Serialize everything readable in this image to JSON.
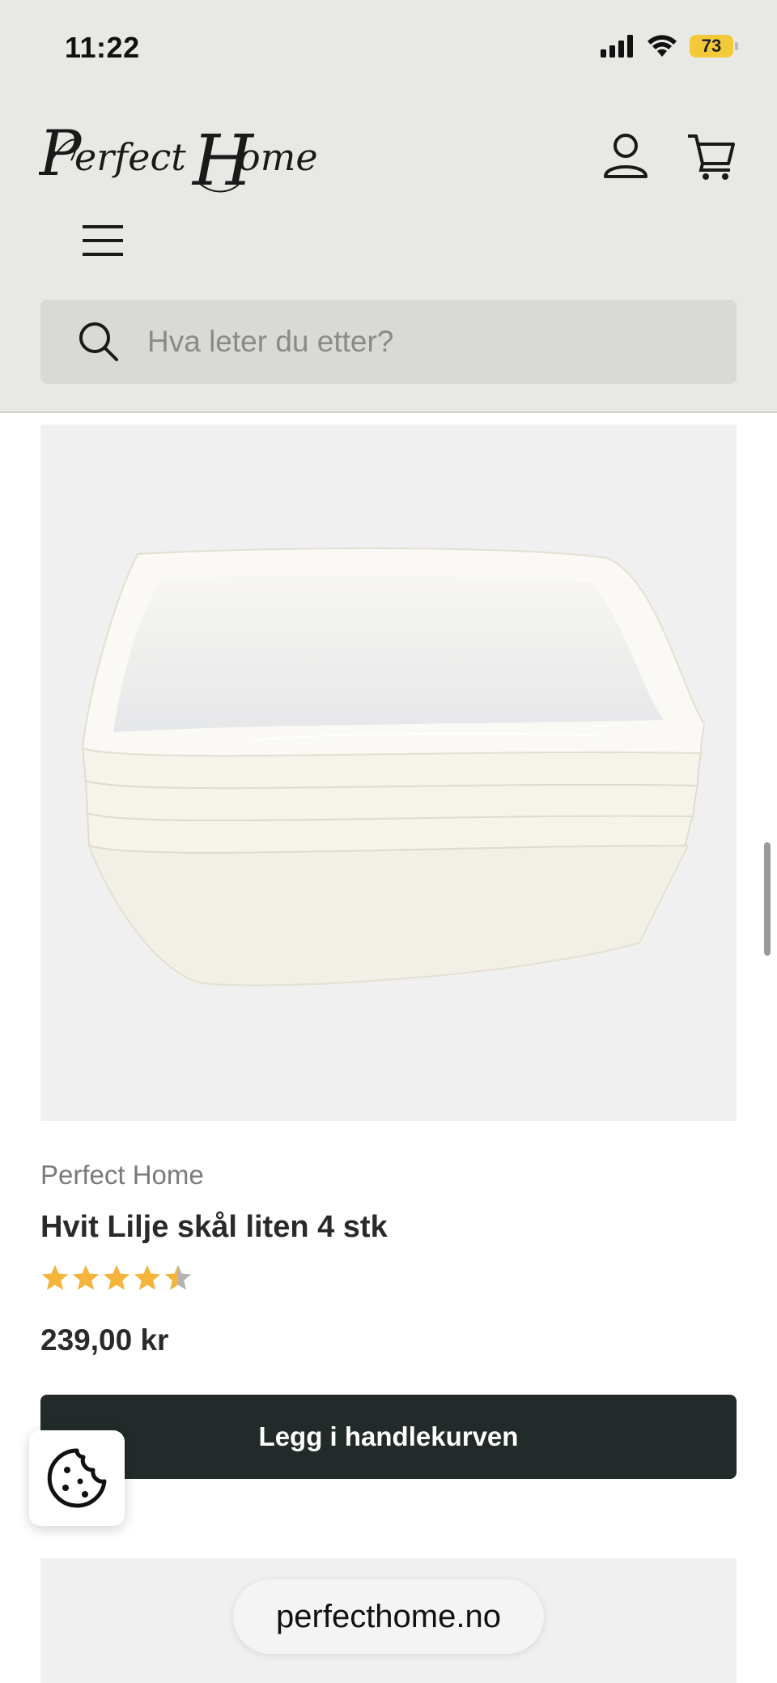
{
  "status_bar": {
    "time": "11:22",
    "battery_level": "73",
    "battery_color": "#f3c93a"
  },
  "header": {
    "logo_text": "Perfect Home",
    "icons": [
      "account-icon",
      "cart-icon",
      "menu-icon"
    ]
  },
  "search": {
    "placeholder": "Hva leter du etter?",
    "icon": "search-icon"
  },
  "product": {
    "vendor": "Perfect Home",
    "title": "Hvit Lilje skål liten 4 stk",
    "rating": 4.5,
    "rating_max": 5,
    "price": "239,00 kr",
    "add_to_cart_label": "Legg i handlekurven"
  },
  "cookie": {
    "icon": "cookie-icon"
  },
  "browser": {
    "url": "perfecthome.no"
  },
  "colors": {
    "header_bg": "#e8e8e5",
    "button_bg": "#232a2a",
    "star": "#f5b53a"
  }
}
